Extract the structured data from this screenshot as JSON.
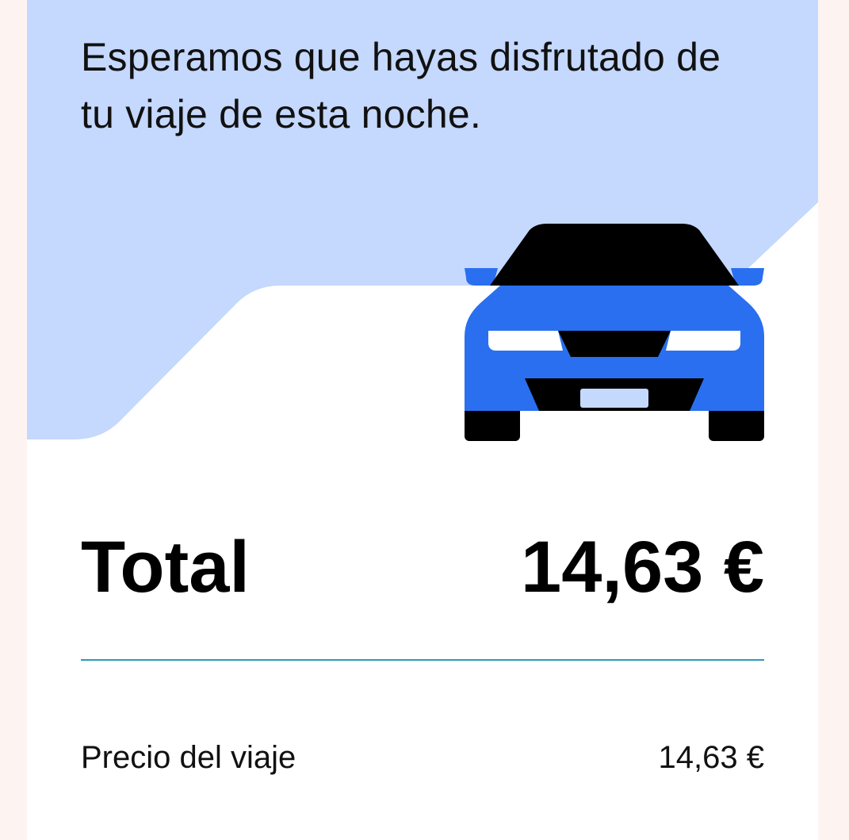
{
  "receipt": {
    "headline": "Esperamos que hayas disfrutado de tu viaje de esta noche.",
    "illustration": "car-front-icon",
    "total_label": "Total",
    "total_value": "14,63 €",
    "lines": [
      {
        "label": "Precio del viaje",
        "value": "14,63 €"
      }
    ]
  },
  "colors": {
    "hero_background": "#c5d8fd",
    "car_body": "#2a6ff0",
    "car_dark": "#000000",
    "divider": "#2a9bb8"
  }
}
